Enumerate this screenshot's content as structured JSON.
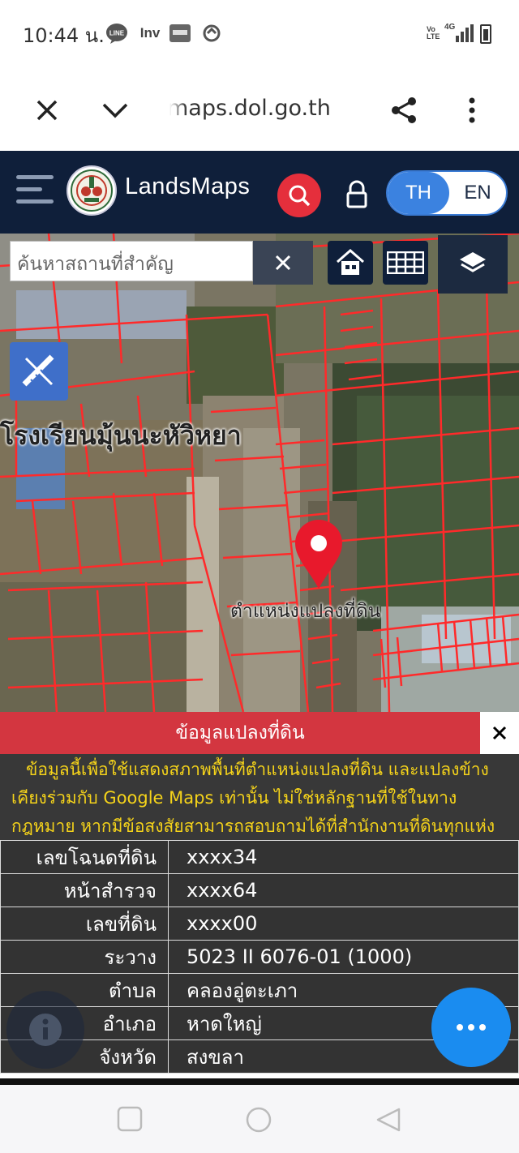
{
  "status_bar": {
    "time": "10:44 น.",
    "icons": [
      "line-icon",
      "inv-icon",
      "lemono-icon",
      "sync-icon",
      "volte-icon",
      "4g-signal-icon",
      "battery-icon"
    ],
    "inv_label": "Inv",
    "volte_label": "Vo LTE",
    "network_label": "4G"
  },
  "browser": {
    "url": "maps.dol.go.th",
    "icons": [
      "close-icon",
      "chevron-down-icon",
      "share-icon",
      "more-vert-icon"
    ]
  },
  "app_header": {
    "brand": "LandsMaps",
    "lang_th": "TH",
    "lang_en": "EN",
    "active_lang": "TH",
    "colors": {
      "header_bg": "#0f1f3a",
      "search_red": "#e52f3c",
      "lang_active": "#3b82e0"
    }
  },
  "map": {
    "search_placeholder": "ค้นหาสถานที่สำคัญ",
    "school_label": "โรงเรียนมุ้นนะหัวิหยา",
    "parcel_label": "ตำแหน่งแปลงที่ดิน",
    "colors": {
      "parcel_line": "#ff2a2a",
      "pin": "#e8192c"
    }
  },
  "info_panel": {
    "title": "ข้อมูลแปลงที่ดิน",
    "disclaimer": "ข้อมูลนี้เพื่อใช้แสดงสภาพพื้นที่ตำแหน่งแปลงที่ดิน และแปลงข้างเคียงร่วมกับ Google Maps เท่านั้น ไม่ใช่หลักฐานที่ใช้ในทางกฎหมาย หากมีข้อสงสัยสามารถสอบถามได้ที่สำนักงานที่ดินทุกแห่ง",
    "rows": [
      {
        "label": "เลขโฉนดที่ดิน",
        "value": "xxxx34"
      },
      {
        "label": "หน้าสำรวจ",
        "value": "xxxx64"
      },
      {
        "label": "เลขที่ดิน",
        "value": "xxxx00"
      },
      {
        "label": "ระวาง",
        "value": "5023 II 6076-01 (1000)"
      },
      {
        "label": "ตำบล",
        "value": "คลองอู่ตะเภา"
      },
      {
        "label": "อำเภอ",
        "value": "หาดใหญ่"
      },
      {
        "label": "จังหวัด",
        "value": "สงขลา"
      }
    ],
    "colors": {
      "title_bg": "#d33640",
      "disclaimer_text": "#f5d31a",
      "fab_blue": "#1a8cf0"
    }
  },
  "nav_bar": {
    "icons": [
      "recent-apps-icon",
      "home-circle-icon",
      "back-triangle-icon"
    ]
  }
}
